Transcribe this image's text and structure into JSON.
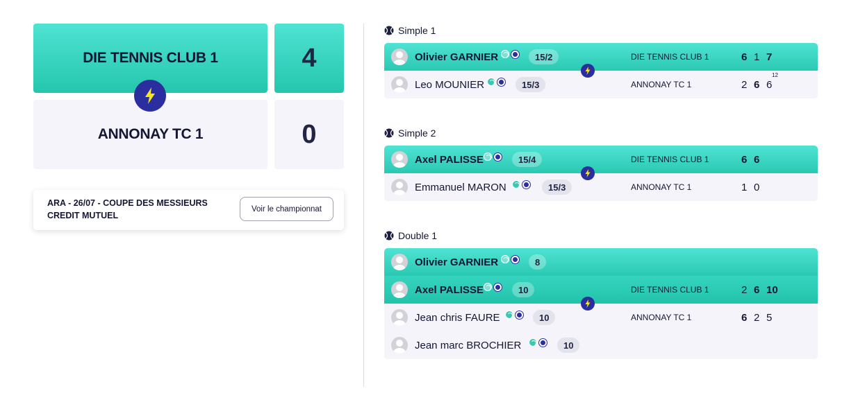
{
  "scoreboard": {
    "home": {
      "name": "DIE TENNIS CLUB 1",
      "score": "4"
    },
    "away": {
      "name": "ANNONAY TC 1",
      "score": "0"
    }
  },
  "championship": {
    "text": "ARA - 26/07 - COUPE DES MESSIEURS CREDIT MUTUEL",
    "button_label": "Voir le championnat"
  },
  "colors": {
    "win": "#2ac9b2",
    "accent": "#2a2e9e",
    "bolt": "#f5e61a",
    "lose_bg": "#f4f4fa"
  },
  "matches": [
    {
      "title": "Simple 1",
      "win_players": [
        {
          "name": "Olivier GARNIER",
          "rank": "15/2"
        }
      ],
      "win_club": "DIE TENNIS CLUB 1",
      "win_scores": [
        "6",
        "1",
        "7"
      ],
      "lose_players": [
        {
          "name": "Leo MOUNIER",
          "rank": "15/3"
        }
      ],
      "lose_club": "ANNONAY TC 1",
      "lose_scores": [
        "2",
        "6",
        "6"
      ],
      "lose_tiebreak": "12"
    },
    {
      "title": "Simple 2",
      "win_players": [
        {
          "name": "Axel PALISSE",
          "rank": "15/4"
        }
      ],
      "win_club": "DIE TENNIS CLUB 1",
      "win_scores": [
        "6",
        "6"
      ],
      "lose_players": [
        {
          "name": "Emmanuel MARON",
          "rank": "15/3"
        }
      ],
      "lose_club": "ANNONAY TC 1",
      "lose_scores": [
        "1",
        "0"
      ]
    },
    {
      "title": "Double 1",
      "win_players": [
        {
          "name": "Olivier GARNIER",
          "rank": "8"
        },
        {
          "name": "Axel PALISSE",
          "rank": "10"
        }
      ],
      "win_club": "DIE TENNIS CLUB 1",
      "win_scores": [
        "2",
        "6",
        "10"
      ],
      "lose_players": [
        {
          "name": "Jean chris FAURE",
          "rank": "10"
        },
        {
          "name": "Jean marc BROCHIER",
          "rank": "10"
        }
      ],
      "lose_club": "ANNONAY TC 1",
      "lose_scores": [
        "6",
        "2",
        "5"
      ]
    }
  ]
}
